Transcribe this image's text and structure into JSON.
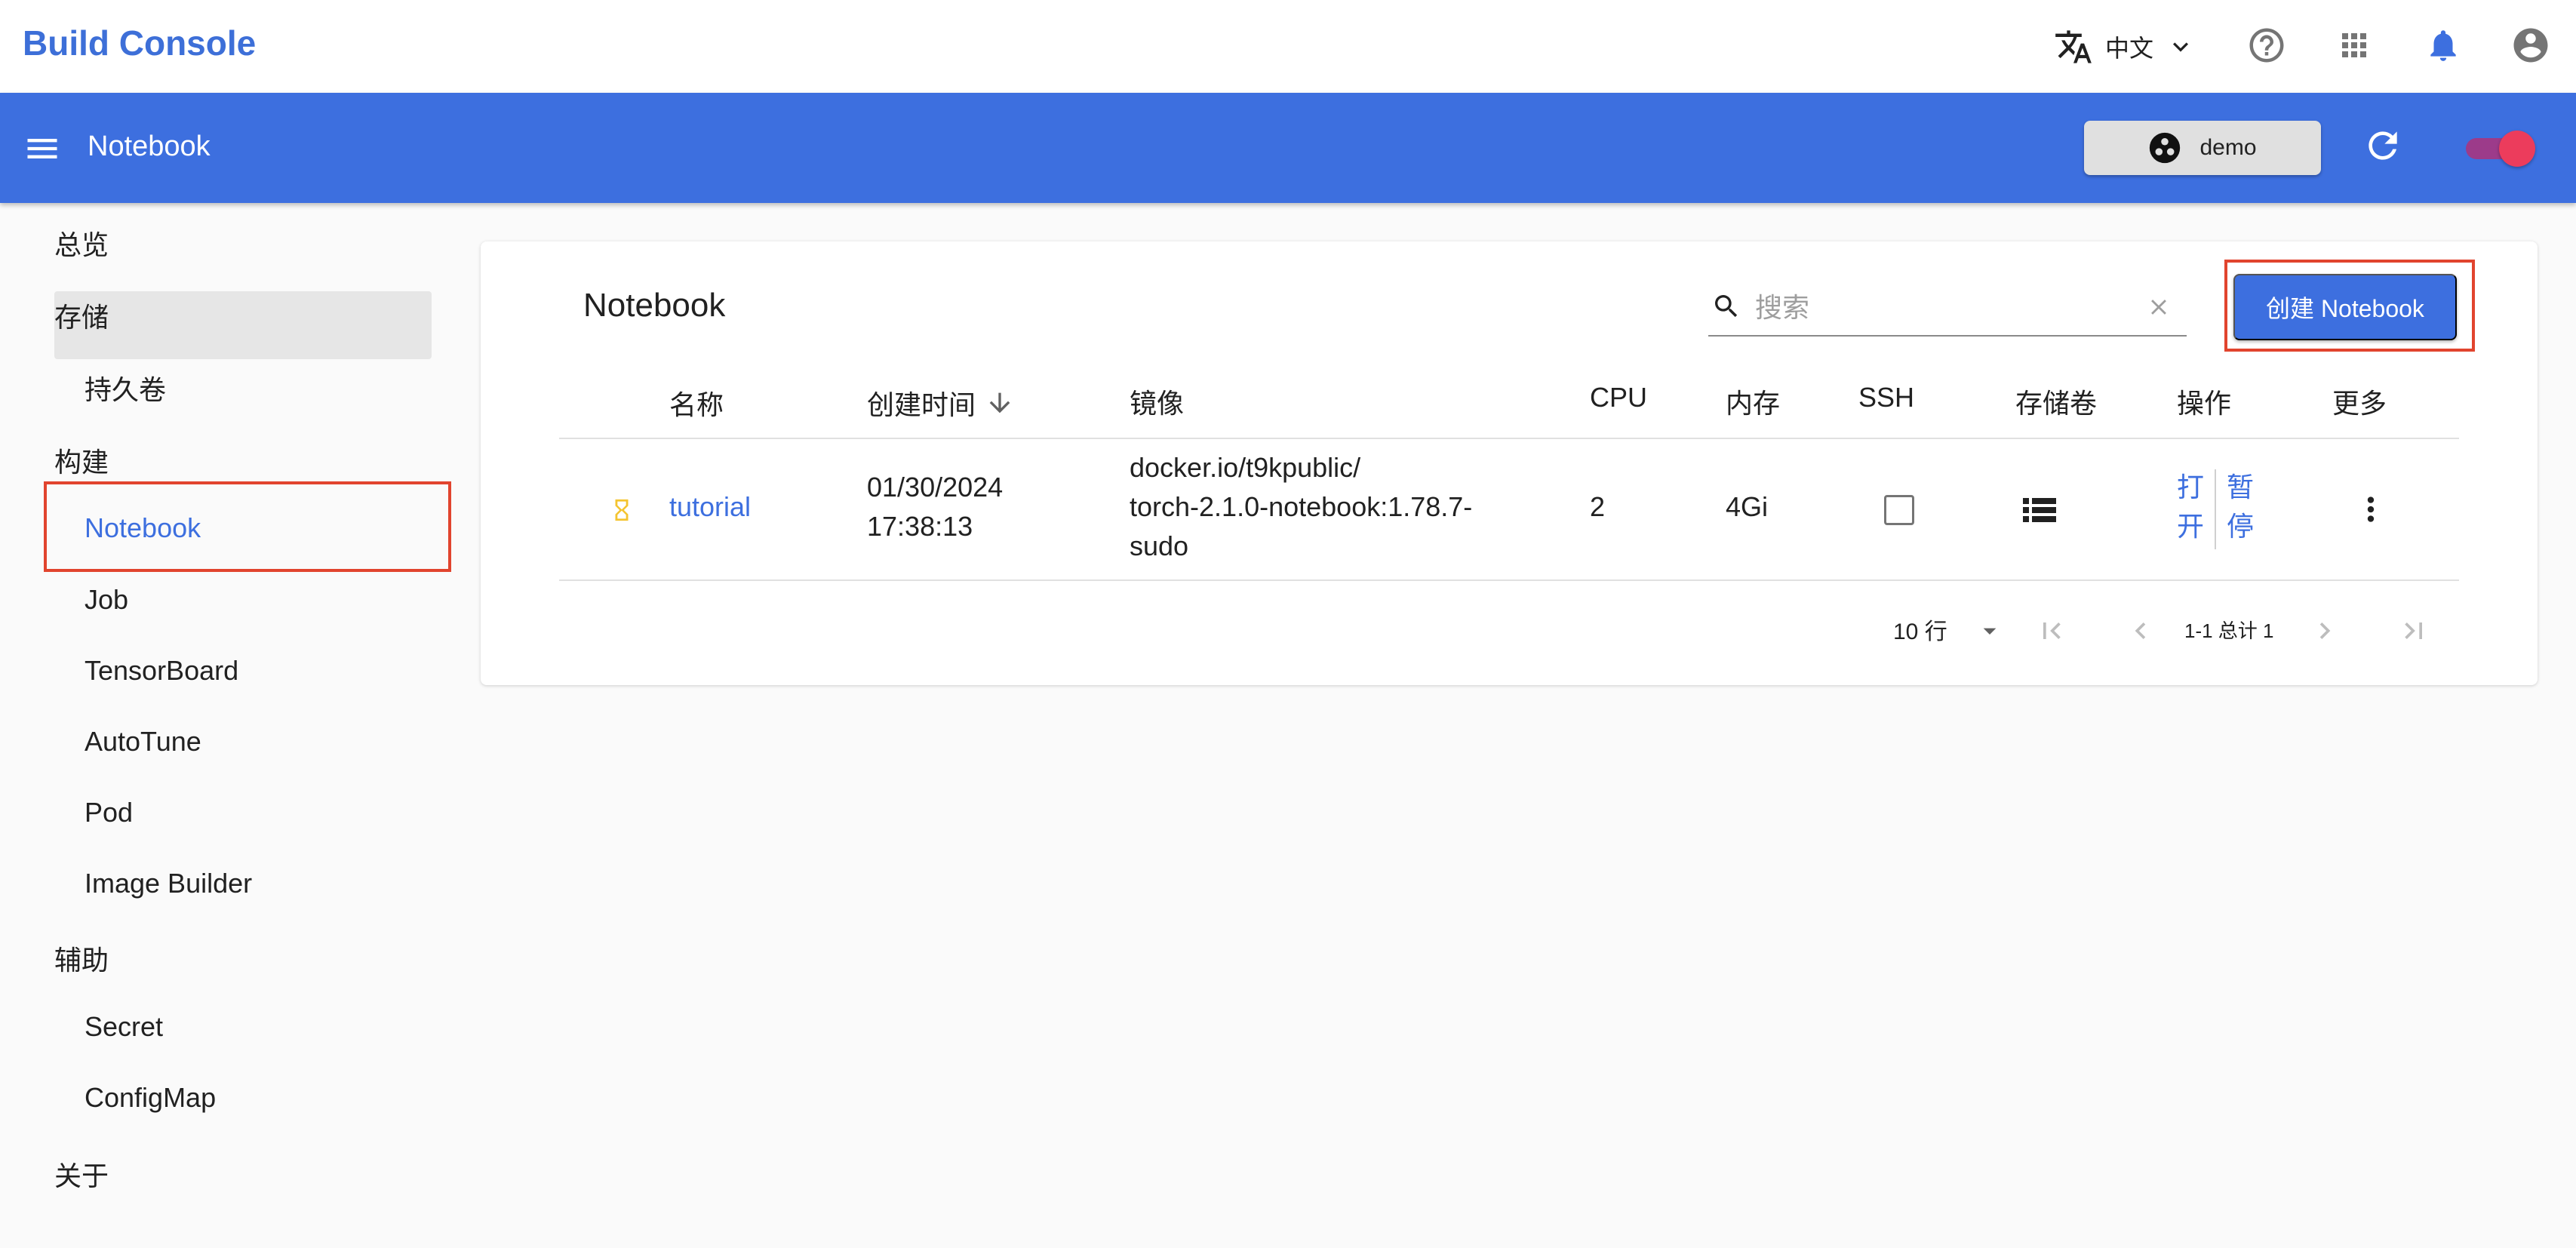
{
  "topbar": {
    "brand": "Build Console",
    "language": "中文",
    "icons": [
      "translate-icon",
      "chevron-down-icon",
      "help-icon",
      "apps-grid-icon",
      "notifications-bell-icon",
      "account-circle-icon"
    ]
  },
  "appbar": {
    "title": "Notebook",
    "namespace": "demo",
    "theme_toggle_on": true
  },
  "sidebar": {
    "items": [
      {
        "label": "总览",
        "level": 0
      },
      {
        "label": "存储",
        "level": 0
      },
      {
        "label": "持久卷",
        "level": 1
      },
      {
        "label": "构建",
        "level": 0
      },
      {
        "label": "Notebook",
        "level": 1,
        "selected": true
      },
      {
        "label": "Job",
        "level": 1
      },
      {
        "label": "TensorBoard",
        "level": 1
      },
      {
        "label": "AutoTune",
        "level": 1
      },
      {
        "label": "Pod",
        "level": 1
      },
      {
        "label": "Image Builder",
        "level": 1
      },
      {
        "label": "辅助",
        "level": 0
      },
      {
        "label": "Secret",
        "level": 1
      },
      {
        "label": "ConfigMap",
        "level": 1
      },
      {
        "label": "关于",
        "level": 0
      }
    ]
  },
  "card": {
    "title": "Notebook",
    "search_placeholder": "搜索",
    "create_button": "创建 Notebook",
    "columns": [
      "名称",
      "创建时间",
      "镜像",
      "CPU",
      "内存",
      "SSH",
      "存储卷",
      "操作",
      "更多"
    ],
    "rows": [
      {
        "status": "pending",
        "name": "tutorial",
        "created_line1": "01/30/2024",
        "created_line2": "17:38:13",
        "image_line1": "docker.io/t9kpublic/",
        "image_line2": "torch-2.1.0-notebook:1.78.7-",
        "image_line3": "sudo",
        "cpu": "2",
        "memory": "4Gi",
        "ssh": false,
        "action_open_1": "打",
        "action_open_2": "开",
        "action_pause_1": "暂",
        "action_pause_2": "停"
      }
    ],
    "pagination": {
      "rows_per_page": "10 行",
      "range": "1-1 总计 1"
    }
  },
  "colors": {
    "primary": "#3d6fdf",
    "highlight": "#e1442e",
    "status_pending": "#f4c430",
    "toggle_knob": "#ec3c5c"
  }
}
